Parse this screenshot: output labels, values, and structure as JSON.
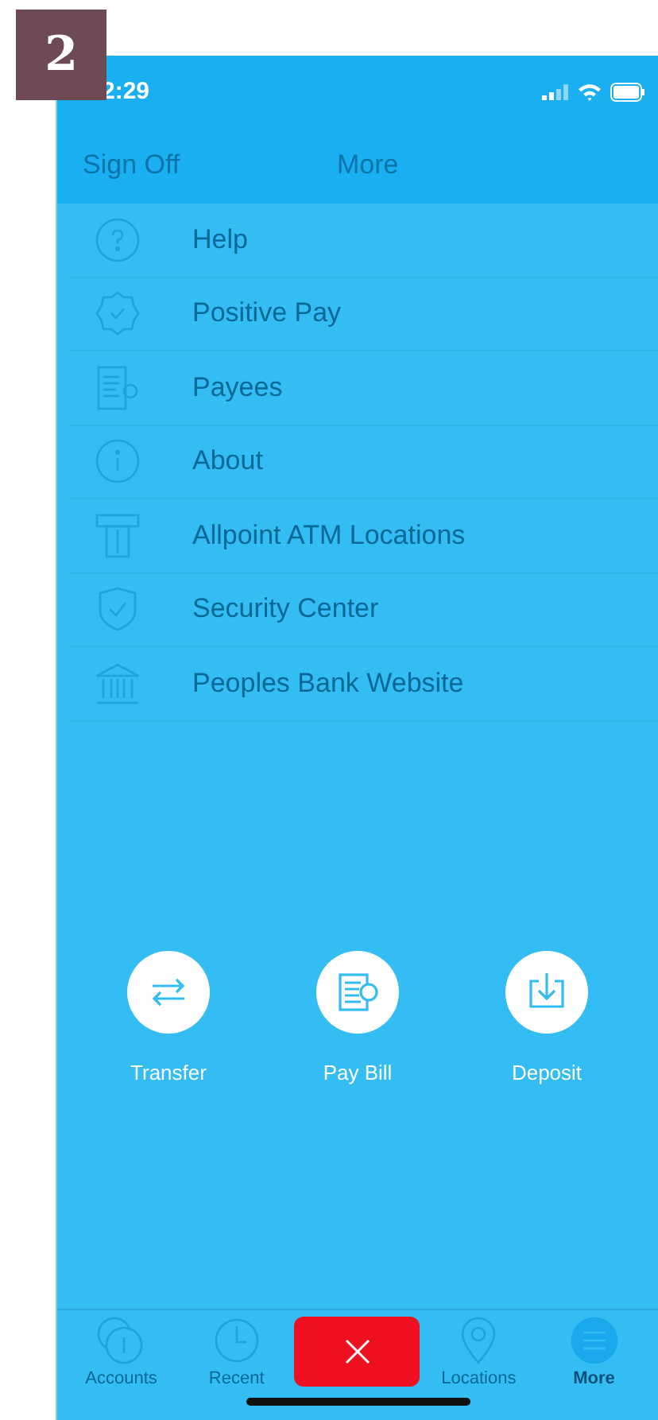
{
  "step_badge": "2",
  "status_bar": {
    "time": "2:29"
  },
  "nav": {
    "left": "Sign Off",
    "title": "More"
  },
  "menu": [
    {
      "label": "Help",
      "kind": "help"
    },
    {
      "label": "Positive Pay",
      "kind": "badge"
    },
    {
      "label": "Payees",
      "kind": "payees"
    },
    {
      "label": "About",
      "kind": "info"
    },
    {
      "label": "Allpoint ATM Locations",
      "kind": "atm"
    },
    {
      "label": "Security Center",
      "kind": "shield"
    },
    {
      "label": "Peoples Bank Website",
      "kind": "bank"
    }
  ],
  "actions": [
    {
      "label": "Transfer",
      "kind": "transfer"
    },
    {
      "label": "Pay Bill",
      "kind": "paybill"
    },
    {
      "label": "Deposit",
      "kind": "deposit"
    }
  ],
  "tabs": [
    {
      "label": "Accounts",
      "kind": "accounts",
      "selected": false
    },
    {
      "label": "Recent",
      "kind": "recent",
      "selected": false
    },
    {
      "label": "Locations",
      "kind": "locations",
      "selected": false
    },
    {
      "label": "More",
      "kind": "more",
      "selected": true
    }
  ]
}
